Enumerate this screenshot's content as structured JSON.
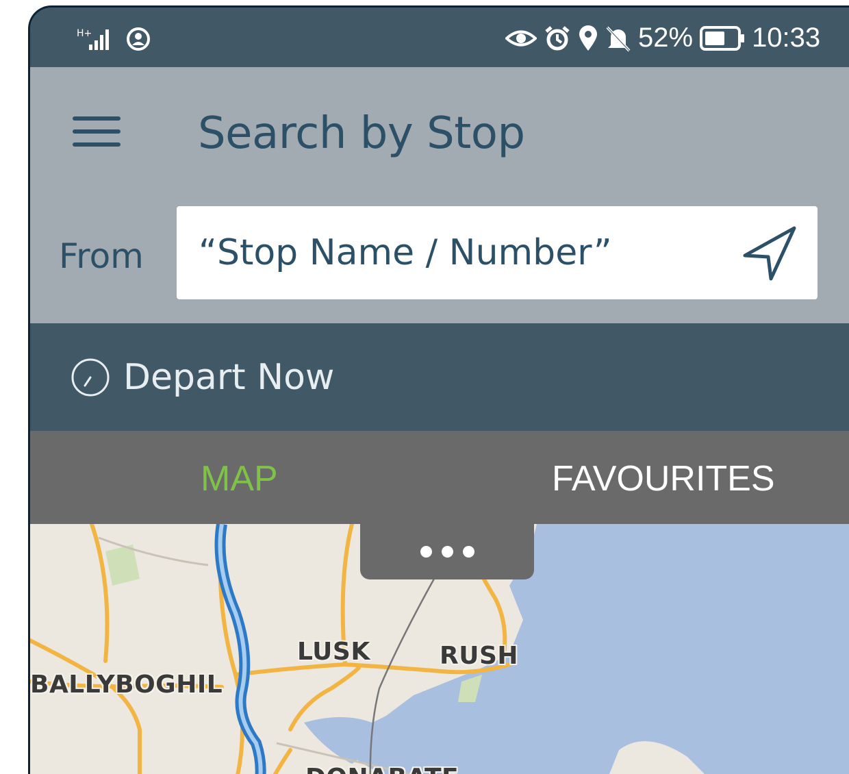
{
  "status_bar": {
    "signal_label": "H+",
    "battery_percent": "52%",
    "time": "10:33",
    "icons": [
      "signal-icon",
      "vpn-icon",
      "eye-icon",
      "alarm-icon",
      "location-icon",
      "mute-icon",
      "battery-icon"
    ]
  },
  "header": {
    "title": "Search by Stop",
    "from_label": "From",
    "stop_input": {
      "value": "",
      "placeholder": "“Stop Name / Number”"
    }
  },
  "depart": {
    "label": "Depart Now"
  },
  "tabs": [
    {
      "label": "MAP",
      "active": true
    },
    {
      "label": "FAVOURITES",
      "active": false
    }
  ],
  "map": {
    "towns": [
      "LUSK",
      "RUSH",
      "BALLYBOGHIL",
      "DONABATE"
    ]
  },
  "colors": {
    "status_bar": "#415966",
    "header": "#a2abb2",
    "primary_text": "#2c5068",
    "tab_bar": "#6a6a6a",
    "tab_active": "#7fc248",
    "sea": "#a8bfdf",
    "land": "#ece8df"
  }
}
